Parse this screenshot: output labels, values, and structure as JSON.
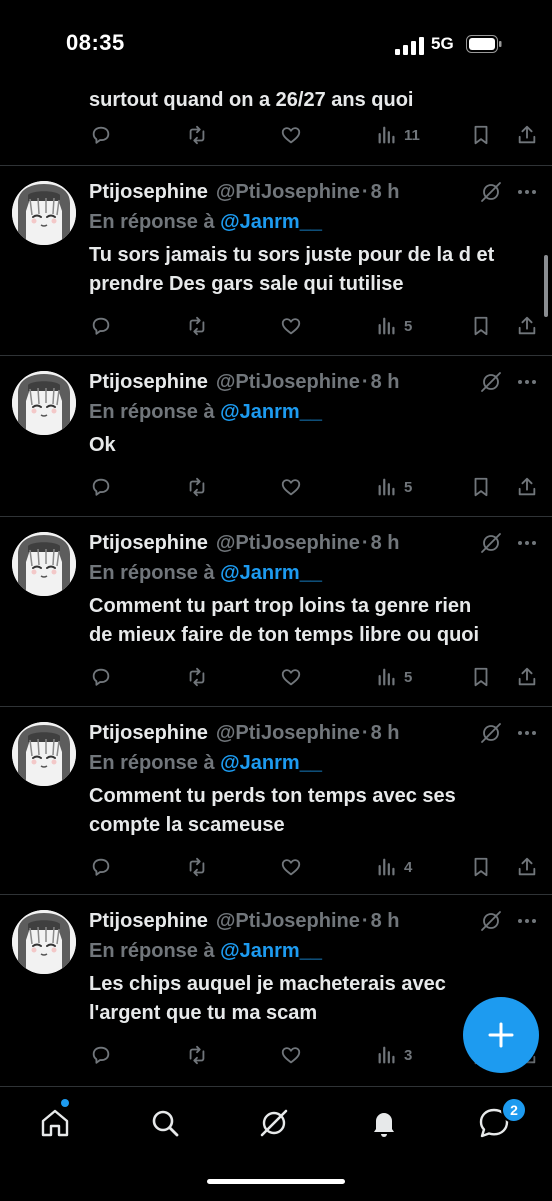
{
  "status": {
    "time": "08:35",
    "network": "5G"
  },
  "top_tweet": {
    "text": "surtout quand on a 26/27 ans quoi",
    "views": "11"
  },
  "tweets": [
    {
      "name": "Ptijosephine",
      "handle": "@PtiJosephine",
      "dot": "·",
      "age": "8 h",
      "reply_prefix": "En réponse à",
      "reply_to": "@Janrm__",
      "lines": [
        "Tu sors jamais tu sors juste pour de la d et",
        "prendre Des gars sale qui tutilise"
      ],
      "views": "5"
    },
    {
      "name": "Ptijosephine",
      "handle": "@PtiJosephine",
      "dot": "·",
      "age": "8 h",
      "reply_prefix": "En réponse à",
      "reply_to": "@Janrm__",
      "lines": [
        "Ok"
      ],
      "views": "5"
    },
    {
      "name": "Ptijosephine",
      "handle": "@PtiJosephine",
      "dot": "·",
      "age": "8 h",
      "reply_prefix": "En réponse à",
      "reply_to": "@Janrm__",
      "lines": [
        "Comment tu part trop loins ta genre rien",
        "de mieux faire de ton temps libre ou quoi"
      ],
      "views": "5"
    },
    {
      "name": "Ptijosephine",
      "handle": "@PtiJosephine",
      "dot": "·",
      "age": "8 h",
      "reply_prefix": "En réponse à",
      "reply_to": "@Janrm__",
      "lines": [
        "Comment tu perds ton temps avec ses",
        "compte la scameuse"
      ],
      "views": "4"
    },
    {
      "name": "Ptijosephine",
      "handle": "@PtiJosephine",
      "dot": "·",
      "age": "8 h",
      "reply_prefix": "En réponse à",
      "reply_to": "@Janrm__",
      "lines": [
        "Les chips auquel je macheterais avec",
        "l'argent que tu ma scam"
      ],
      "views": "3"
    }
  ],
  "tabbar": {
    "items": [
      "home-icon",
      "search-icon",
      "grok-icon",
      "notifications-icon",
      "messages-icon"
    ],
    "messages_badge": "2"
  },
  "colors": {
    "accent": "#1d9bf0",
    "background": "#000000",
    "muted": "#71767b",
    "text": "#e7e9ea"
  }
}
